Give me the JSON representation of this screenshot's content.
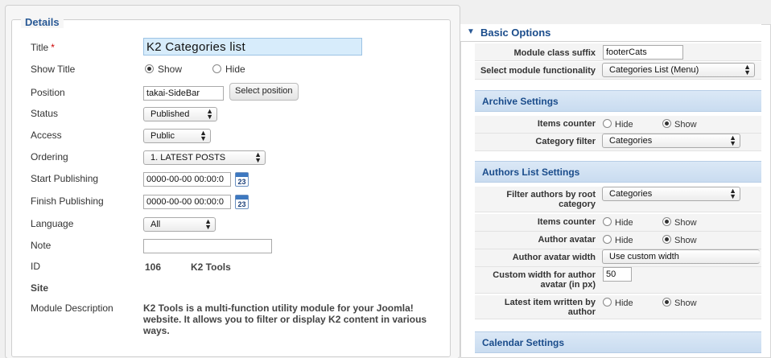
{
  "details": {
    "legend": "Details",
    "fields": {
      "title_label": "Title",
      "title_required": "*",
      "title_value": "K2 Categories list",
      "show_title_label": "Show Title",
      "show_title_show": "Show",
      "show_title_hide": "Hide",
      "position_label": "Position",
      "position_value": "takai-SideBar",
      "select_position_button": "Select position",
      "status_label": "Status",
      "status_value": "Published",
      "access_label": "Access",
      "access_value": "Public",
      "ordering_label": "Ordering",
      "ordering_value": "1. LATEST POSTS",
      "start_publishing_label": "Start Publishing",
      "start_publishing_value": "0000-00-00 00:00:0",
      "finish_publishing_label": "Finish Publishing",
      "finish_publishing_value": "0000-00-00 00:00:0",
      "calendar_day": "23",
      "language_label": "Language",
      "language_value": "All",
      "note_label": "Note",
      "note_value": "",
      "id_label": "ID",
      "id_value": "106",
      "id_module": "K2 Tools",
      "site_label": "Site",
      "module_description_label": "Module Description",
      "module_description_value": "K2 Tools is a multi-function utility module for your Joomla! website. It allows you to filter or display K2 content in various ways."
    }
  },
  "basic_options": {
    "title": "Basic Options",
    "module_class_suffix_label": "Module class suffix",
    "module_class_suffix_value": "footerCats",
    "select_functionality_label": "Select module functionality",
    "select_functionality_value": "Categories List (Menu)"
  },
  "archive_settings": {
    "title": "Archive Settings",
    "items_counter_label": "Items counter",
    "hide": "Hide",
    "show": "Show",
    "category_filter_label": "Category filter",
    "category_filter_value": "Categories"
  },
  "authors_list_settings": {
    "title": "Authors List Settings",
    "filter_authors_label": "Filter authors by root category",
    "filter_authors_value": "Categories",
    "items_counter_label": "Items counter",
    "author_avatar_label": "Author avatar",
    "author_avatar_width_label": "Author avatar width",
    "author_avatar_width_value": "Use custom width",
    "custom_width_label": "Custom width for author avatar (in px)",
    "custom_width_value": "50",
    "latest_item_label": "Latest item written by author",
    "hide": "Hide",
    "show": "Show"
  },
  "calendar_settings": {
    "title": "Calendar Settings"
  },
  "colors": {
    "accent": "#1a4c8b",
    "title_input_bg": "#d7ecfb",
    "section_bar": "#d3e3f4"
  }
}
